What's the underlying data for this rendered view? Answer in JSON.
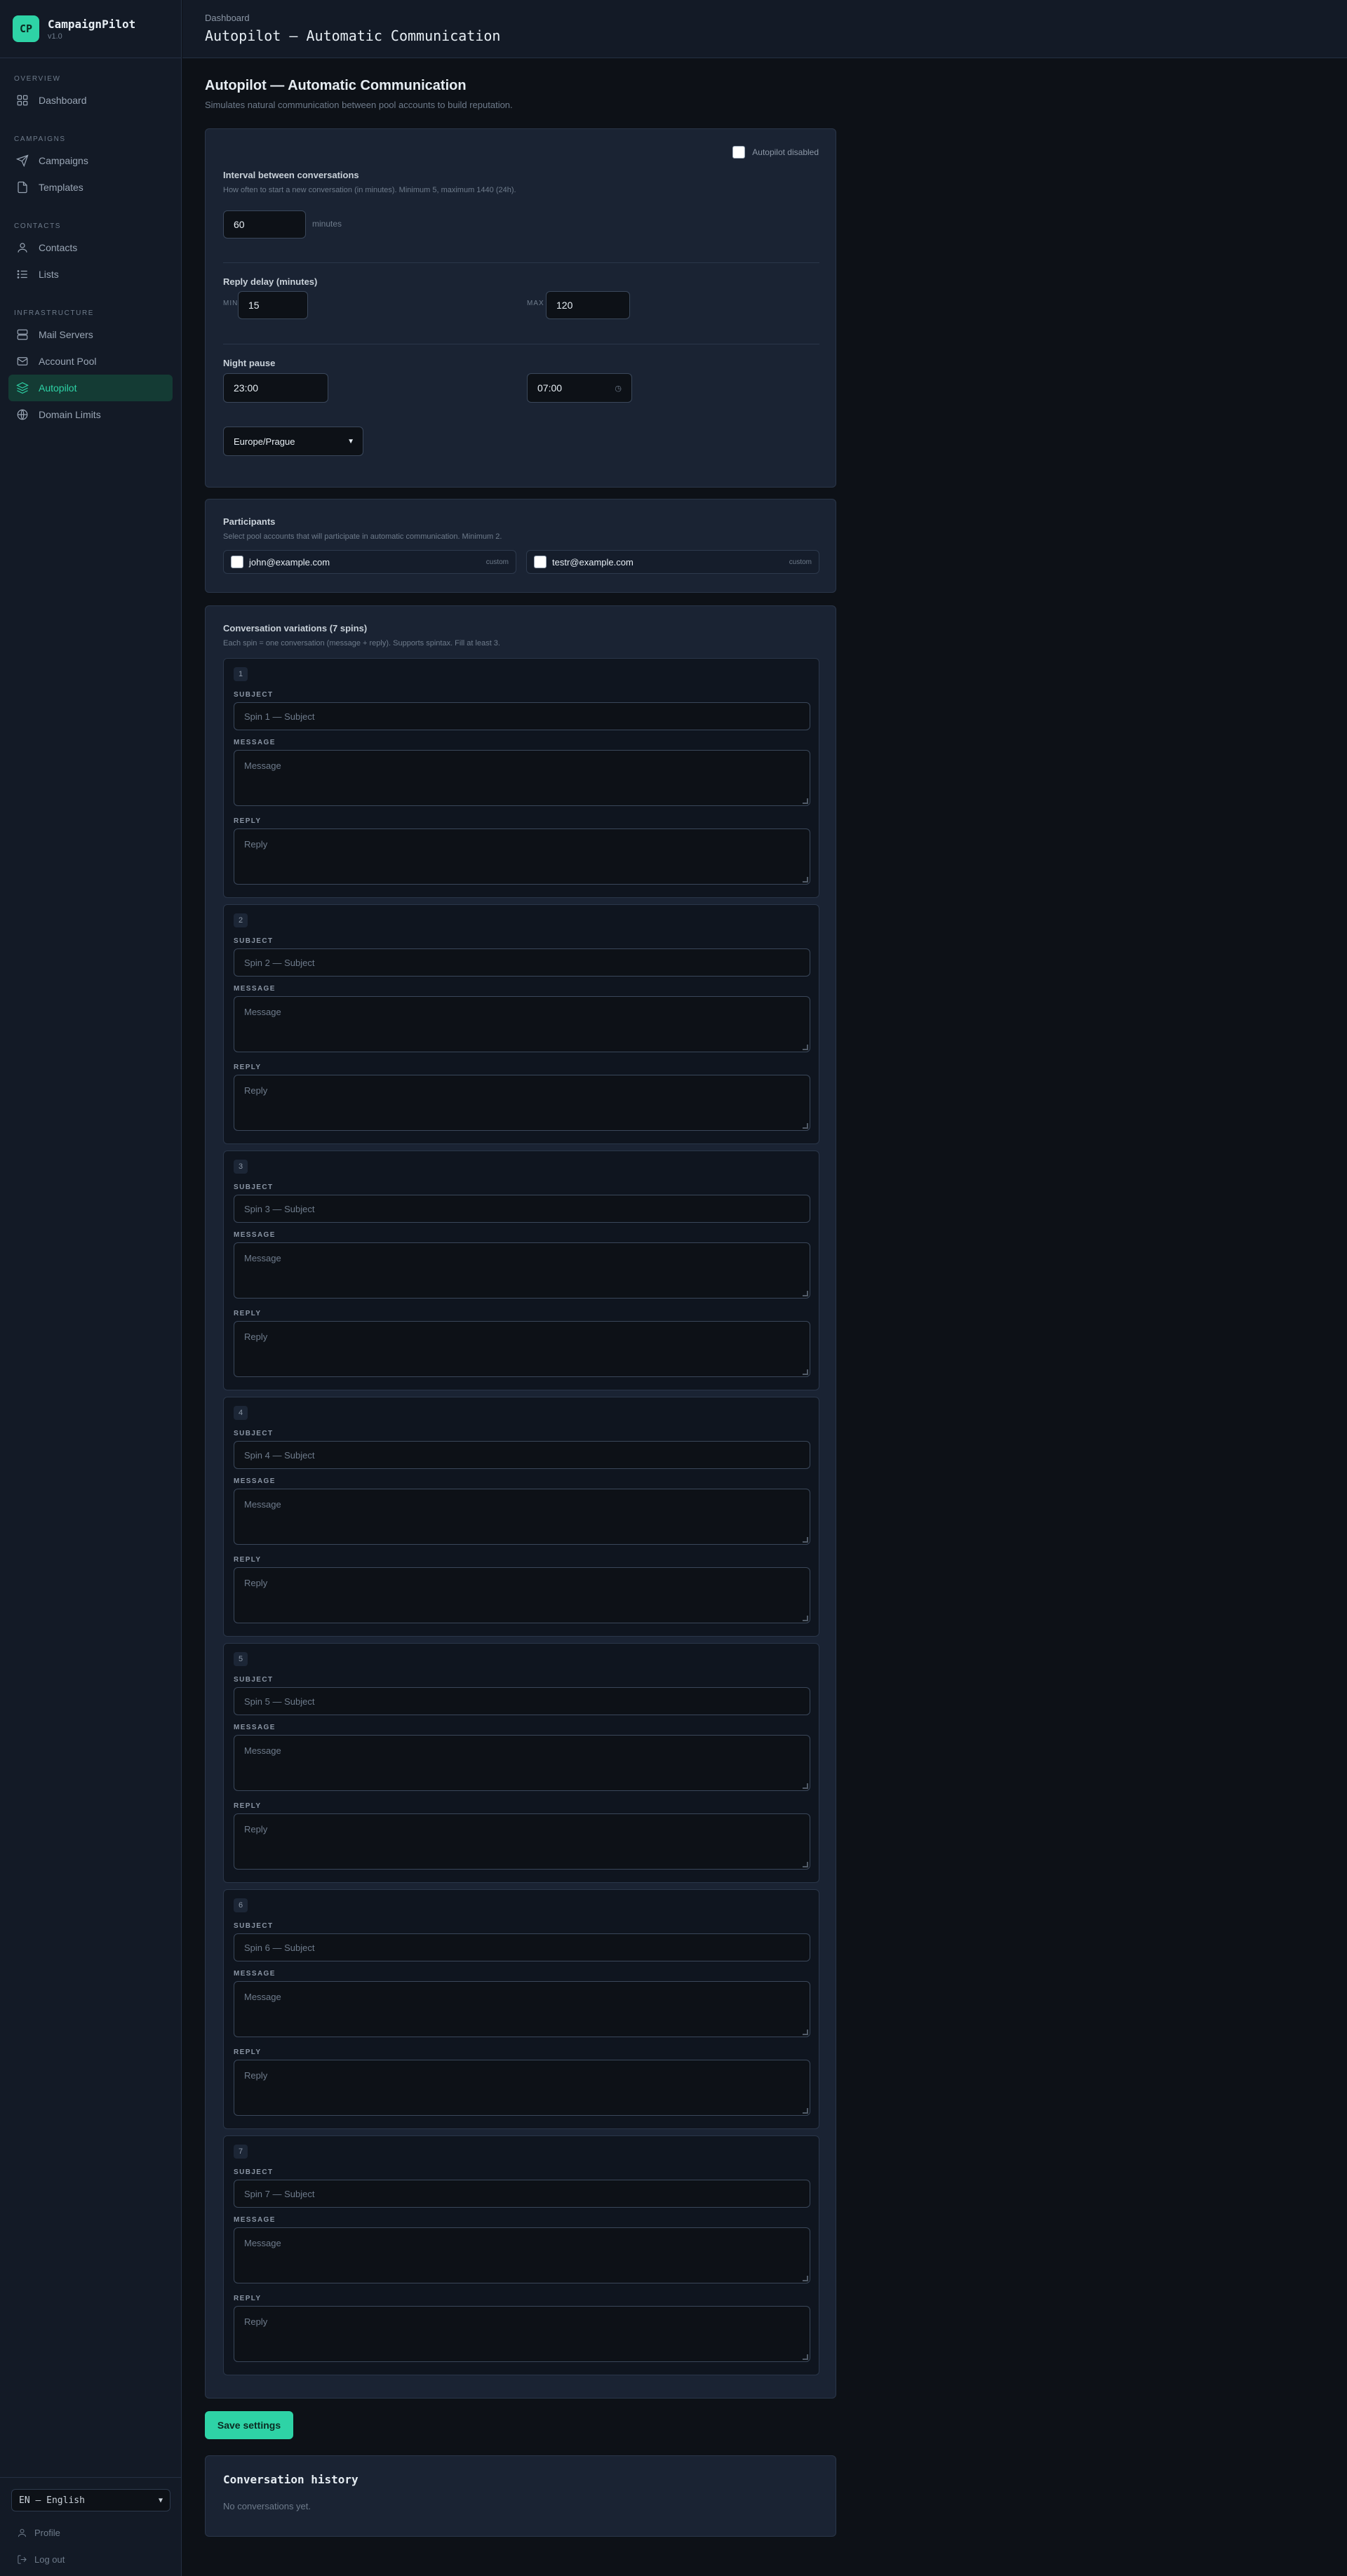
{
  "app": {
    "name": "CampaignPilot",
    "version": "v1.0"
  },
  "sidebar": {
    "sections": [
      {
        "title": "Overview",
        "items": [
          {
            "label": "Dashboard",
            "icon": "grid-icon"
          }
        ]
      },
      {
        "title": "Campaigns",
        "items": [
          {
            "label": "Campaigns",
            "icon": "send-icon"
          },
          {
            "label": "Templates",
            "icon": "file-icon"
          }
        ]
      },
      {
        "title": "Contacts",
        "items": [
          {
            "label": "Contacts",
            "icon": "user-icon"
          },
          {
            "label": "Lists",
            "icon": "list-icon"
          }
        ]
      },
      {
        "title": "Infrastructure",
        "items": [
          {
            "label": "Mail Servers",
            "icon": "server-icon"
          },
          {
            "label": "Account Pool",
            "icon": "mail-icon"
          },
          {
            "label": "Autopilot",
            "icon": "layers-icon",
            "active": true
          },
          {
            "label": "Domain Limits",
            "icon": "globe-icon"
          }
        ]
      }
    ],
    "language": "EN — English",
    "profile_label": "Profile",
    "logout_label": "Log out"
  },
  "header": {
    "breadcrumb": "Dashboard",
    "title": "Autopilot — Automatic Communication"
  },
  "page": {
    "title": "Autopilot — Automatic Communication",
    "subtitle": "Simulates natural communication between pool accounts to build reputation."
  },
  "settings": {
    "autopilot_toggle_label": "Autopilot disabled",
    "interval_label": "Interval between conversations",
    "interval_hint": "How often to start a new conversation (in minutes). Minimum 5, maximum 1440 (24h).",
    "interval_value": "60",
    "interval_unit": "minutes",
    "reply_delay_label": "Reply delay (minutes)",
    "min_label": "MIN",
    "min_value": "15",
    "max_label": "MAX",
    "max_value": "120",
    "night_pause_label": "Night pause",
    "night_start": "23:00",
    "night_end": "07:00",
    "timezone": "Europe/Prague"
  },
  "participants": {
    "label": "Participants",
    "hint": "Select pool accounts that will participate in automatic communication. Minimum 2.",
    "accounts": [
      {
        "email": "john@example.com",
        "tag": "custom"
      },
      {
        "email": "testr@example.com",
        "tag": "custom"
      }
    ]
  },
  "variations": {
    "label": "Conversation variations (7 spins)",
    "hint": "Each spin = one conversation (message + reply). Supports spintax. Fill at least 3.",
    "subject_label": "SUBJECT",
    "message_label": "MESSAGE",
    "reply_label": "REPLY",
    "message_placeholder": "Message",
    "reply_placeholder": "Reply",
    "spins": [
      {
        "num": "1",
        "subject_placeholder": "Spin 1 — Subject"
      },
      {
        "num": "2",
        "subject_placeholder": "Spin 2 — Subject"
      },
      {
        "num": "3",
        "subject_placeholder": "Spin 3 — Subject"
      },
      {
        "num": "4",
        "subject_placeholder": "Spin 4 — Subject"
      },
      {
        "num": "5",
        "subject_placeholder": "Spin 5 — Subject"
      },
      {
        "num": "6",
        "subject_placeholder": "Spin 6 — Subject"
      },
      {
        "num": "7",
        "subject_placeholder": "Spin 7 — Subject"
      }
    ]
  },
  "actions": {
    "save_label": "Save settings"
  },
  "history": {
    "title": "Conversation history",
    "empty": "No conversations yet."
  },
  "colors": {
    "accent": "#2ed3a6",
    "background": "#0d1117",
    "surface": "#1a2333"
  }
}
